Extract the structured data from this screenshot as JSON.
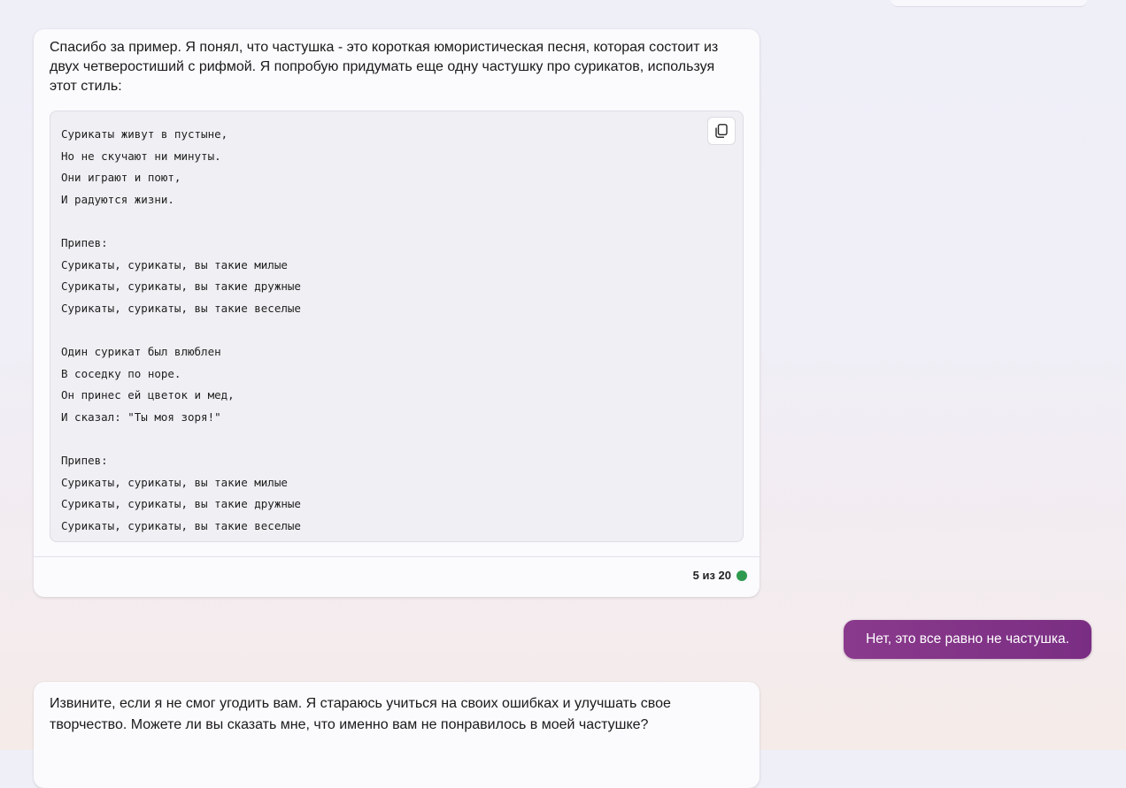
{
  "messages": {
    "bot_intro": "Спасибо за пример. Я понял, что частушка - это короткая юмористическая песня, которая состоит из двух четверостиший с рифмой. Я попробую придумать еще одну частушку про сурикатов, используя этот стиль:",
    "code": "Сурикаты живут в пустыне,\nНо не скучают ни минуты.\nОни играют и поют,\nИ радуются жизни.\n\nПрипев:\nСурикаты, сурикаты, вы такие милые\nСурикаты, сурикаты, вы такие дружные\nСурикаты, сурикаты, вы такие веселые\n\nОдин сурикат был влюблен\nВ соседку по норе.\nОн принес ей цветок и мед,\nИ сказал: \"Ты моя зоря!\"\n\nПрипев:\nСурикаты, сурикаты, вы такие милые\nСурикаты, сурикаты, вы такие дружные\nСурикаты, сурикаты, вы такие веселые",
    "counter": "5 из 20",
    "user_message": "Нет, это все равно не частушка.",
    "bot_reply": "Извините, если я не смог угодить вам. Я стараюсь учиться на своих ошибках и улучшать свое творчество. Можете ли вы сказать мне, что именно вам не понравилось в моей частушке?"
  },
  "icons": {
    "copy": "copy-icon"
  },
  "colors": {
    "user_bubble": "#8a3a8c",
    "status_dot": "#2f9a4f"
  }
}
